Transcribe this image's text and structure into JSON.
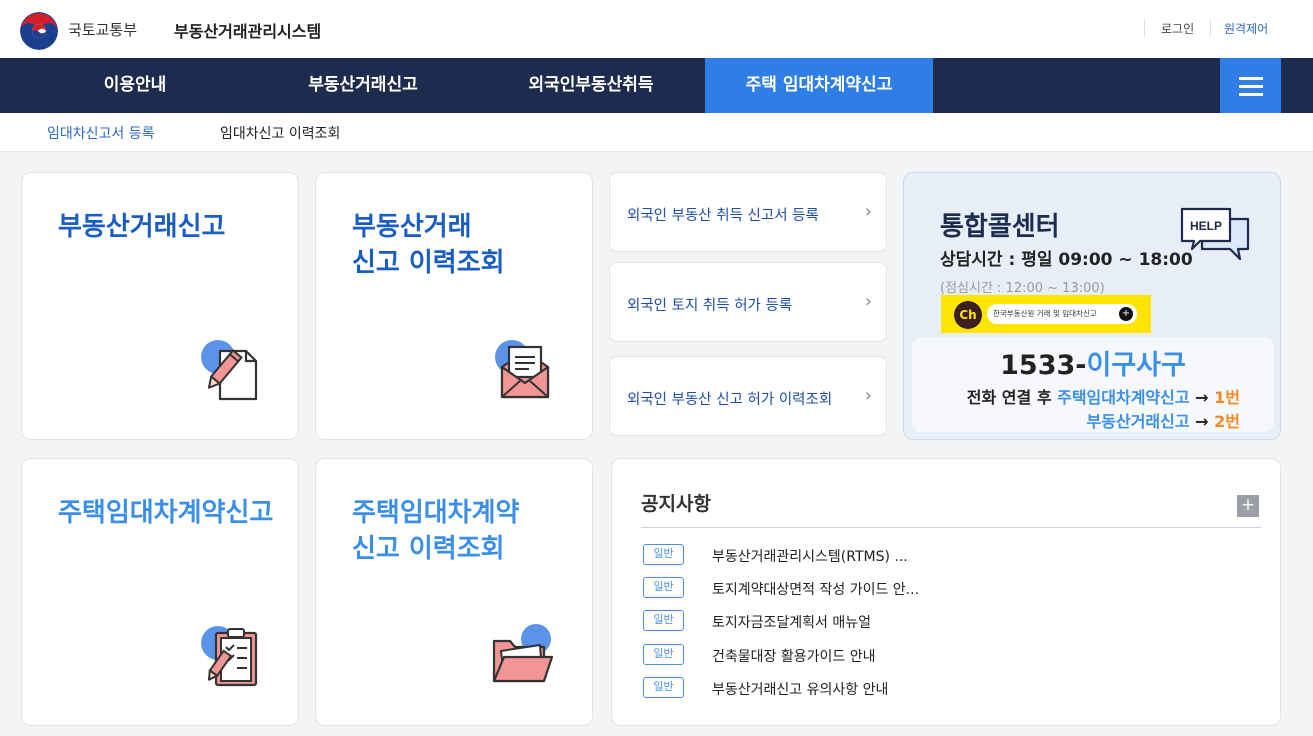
{
  "header": {
    "ministry": "국토교통부",
    "system_title": "부동산거래관리시스템",
    "login": "로그인",
    "remote_control": "원격제어"
  },
  "nav": {
    "items": [
      "이용안내",
      "부동산거래신고",
      "외국인부동산취득",
      "주택 임대차계약신고"
    ],
    "active_index": 3,
    "menu_icon": "hamburger-icon"
  },
  "subnav": {
    "items": [
      "임대차신고서 등록",
      "임대차신고 이력조회"
    ],
    "active_index": 0
  },
  "cards": [
    {
      "title": "부동산거래신고",
      "icon": "pencil-document-icon"
    },
    {
      "title": "부동산거래\n신고 이력조회",
      "icon": "envelope-document-icon"
    },
    {
      "title": "주택임대차계약신고",
      "icon": "clipboard-checklist-icon"
    },
    {
      "title": "주택임대차계약\n신고 이력조회",
      "icon": "open-folder-icon"
    }
  ],
  "links": [
    {
      "label": "외국인 부동산 취득 신고서 등록"
    },
    {
      "label": "외국인 토지 취득 허가 등록"
    },
    {
      "label": "외국인 부동산 신고 허가 이력조회"
    }
  ],
  "call_center": {
    "title": "통합콜센터",
    "hours": "상담시간 : 평일 09:00 ~ 18:00",
    "lunch": "(점심시간 : 12:00 ~ 13:00)",
    "help_badge": "HELP",
    "kakao_ch": "Ch",
    "kakao_text": "한국부동산원 거래 및 임대차신고",
    "phone_number": "1533-",
    "phone_word": "이구사구",
    "route1_prefix": "전화 연결 후 ",
    "route1_name": "주택임대차계약신고",
    "route1_arrow": " → ",
    "route1_order": "1번",
    "route2_name": "부동산거래신고",
    "route2_arrow": " → ",
    "route2_order": "2번"
  },
  "notice": {
    "title": "공지사항",
    "more": "+",
    "items": [
      {
        "badge": "일반",
        "text": "부동산거래관리시스템(RTMS) ..."
      },
      {
        "badge": "일반",
        "text": "토지계약대상면적 작성 가이드 안..."
      },
      {
        "badge": "일반",
        "text": "토지자금조달계획서 매뉴얼"
      },
      {
        "badge": "일반",
        "text": "건축물대장 활용가이드 안내"
      },
      {
        "badge": "일반",
        "text": "부동산거래신고 유의사항 안내"
      }
    ]
  },
  "colors": {
    "nav_bg": "#1d2b4f",
    "accent": "#2f7ee5",
    "title_dark_blue": "#1a5dc3",
    "title_light_blue": "#3b8fe6",
    "orange": "#f08a24"
  }
}
